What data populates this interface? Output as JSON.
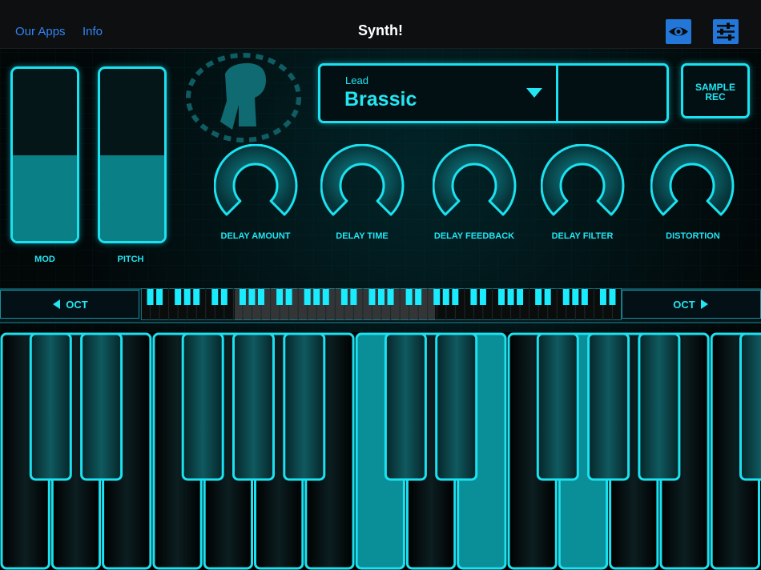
{
  "header": {
    "title": "Synth!",
    "our_apps": "Our Apps",
    "info": "Info",
    "eye_button": "eye-icon",
    "settings_button": "sliders-icon"
  },
  "sliders": [
    {
      "label": "MOD",
      "level": 0.5
    },
    {
      "label": "PITCH",
      "level": 0.5
    }
  ],
  "preset": {
    "category": "Lead",
    "name": "Brassic"
  },
  "sample_rec": {
    "line1": "SAMPLE",
    "line2": "REC"
  },
  "knobs": [
    {
      "label": "DELAY AMOUNT"
    },
    {
      "label": "DELAY TIME"
    },
    {
      "label": "DELAY FEEDBACK"
    },
    {
      "label": "DELAY FILTER"
    },
    {
      "label": "DISTORTION"
    }
  ],
  "octave": {
    "down_label": "OCT",
    "up_label": "OCT"
  },
  "colors": {
    "accent": "#1be1f0",
    "accent_dim": "#0a7f86",
    "link": "#2f86f6",
    "button": "#2277d8"
  }
}
